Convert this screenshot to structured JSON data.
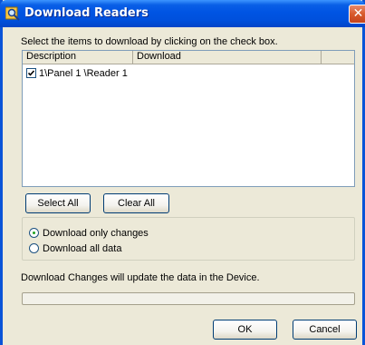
{
  "window": {
    "title": "Download Readers",
    "close_glyph": "✕"
  },
  "instruction": "Select the items to download by clicking on the check box.",
  "list": {
    "columns": [
      "Description",
      "Download"
    ],
    "rows": [
      {
        "label": "1\\Panel 1 \\Reader 1",
        "checked": true
      }
    ]
  },
  "buttons": {
    "select_all": "Select All",
    "clear_all": "Clear All",
    "ok": "OK",
    "cancel": "Cancel"
  },
  "options": {
    "only_changes": "Download only changes",
    "all_data": "Download all data",
    "selected": "only_changes"
  },
  "status_text": "Download Changes will update the data in the Device.",
  "progress": 0
}
